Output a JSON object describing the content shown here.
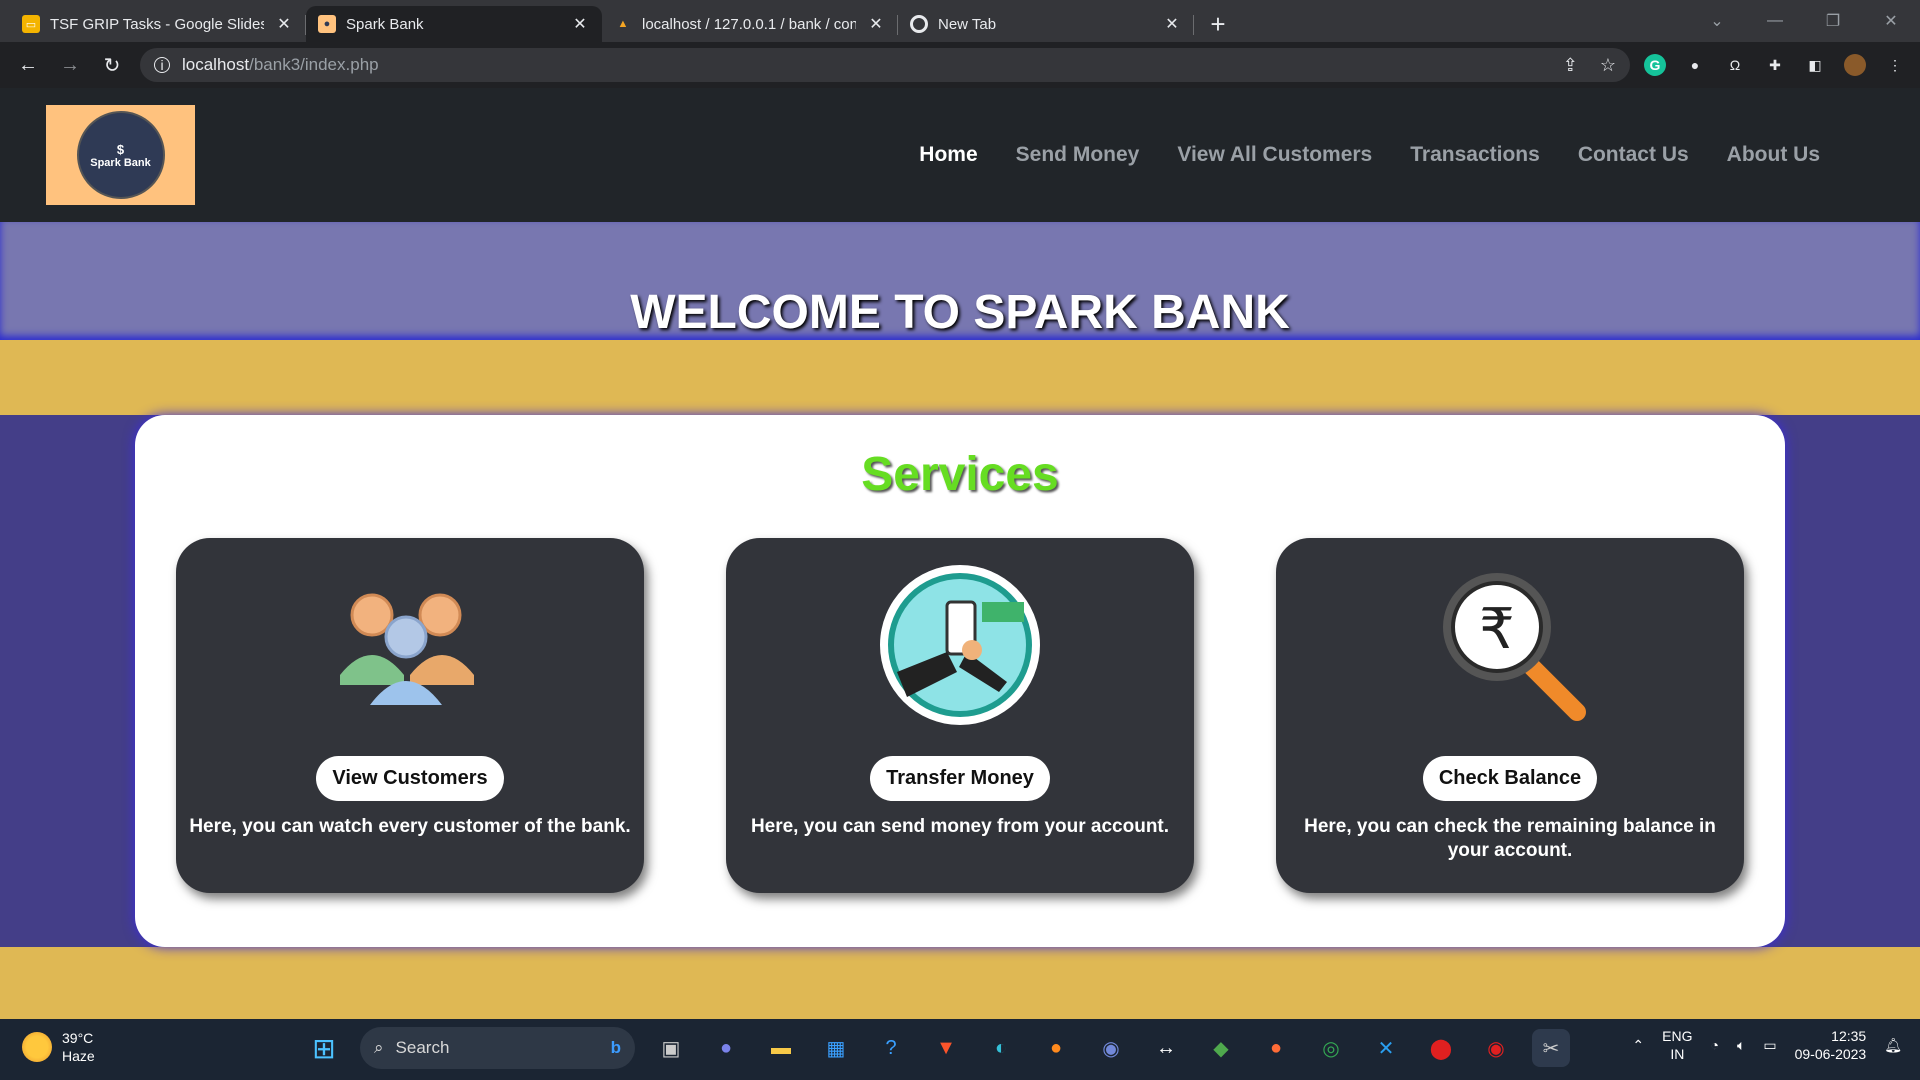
{
  "browser": {
    "tabs": [
      {
        "title": "TSF GRIP Tasks - Google Slides",
        "icon": "slides-icon",
        "color": "#f4b400"
      },
      {
        "title": "Spark Bank",
        "icon": "site-favicon",
        "color": "#ffc27e"
      },
      {
        "title": "localhost / 127.0.0.1 / bank / con",
        "icon": "phpmyadmin-icon",
        "color": "#f8a"
      },
      {
        "title": "New Tab",
        "icon": "chrome-icon",
        "color": "#e8eaed"
      }
    ],
    "close_glyph": "✕",
    "new_tab_glyph": "+",
    "url_host": "localhost",
    "url_path": "/bank3/index.php"
  },
  "site": {
    "logo": {
      "symbol": "$",
      "name": "Spark Bank"
    },
    "nav": [
      "Home",
      "Send Money",
      "View All Customers",
      "Transactions",
      "Contact Us",
      "About Us"
    ],
    "hero_title": "WELCOME TO SPARK BANK",
    "services_title": "Services",
    "cards": [
      {
        "button": "View Customers",
        "desc": "Here, you can watch every customer of the bank.",
        "icon": "customers-icon"
      },
      {
        "button": "Transfer Money",
        "desc": "Here, you can send money from your account.",
        "icon": "mobile-payment-icon"
      },
      {
        "button": "Check Balance",
        "desc": "Here, you can check the remaining balance in your account.",
        "icon": "rupee-magnifier-icon"
      }
    ]
  },
  "taskbar": {
    "weather_temp": "39°C",
    "weather_desc": "Haze",
    "search_label": "Search",
    "lang_1": "ENG",
    "lang_2": "IN",
    "time": "12:35",
    "date": "09-06-2023"
  },
  "colors": {
    "header_bg": "#212529",
    "hero_bg": "#7877b0",
    "band": "#dfb854",
    "services_bg": "#443e88",
    "services_title": "#66dd22",
    "card_bg": "#32343a"
  }
}
